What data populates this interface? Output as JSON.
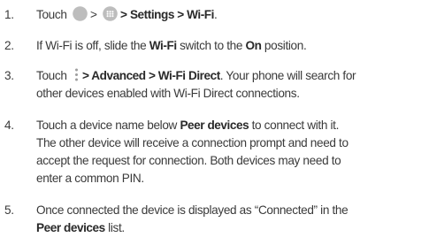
{
  "steps": [
    {
      "number": "1.",
      "touch": "Touch",
      "sep1": ">",
      "sep2": ">",
      "path": "Settings > Wi-Fi",
      "period": "."
    },
    {
      "number": "2.",
      "pre": "If Wi-Fi is off, slide the ",
      "bold1": "Wi-Fi",
      "mid": " switch to the ",
      "bold2": "On",
      "post": " position."
    },
    {
      "number": "3.",
      "touch": "Touch",
      "path": "> Advanced > Wi-Fi Direct",
      "rest_line1": ". Your phone will search for",
      "line2": "other devices enabled with Wi-Fi Direct connections."
    },
    {
      "number": "4.",
      "pre": "Touch a device name below ",
      "bold": "Peer devices",
      "post": " to connect with it.",
      "line2": "The other device will receive a connection prompt and need to",
      "line3": "accept the request for connection. Both devices may need to",
      "line4": "enter a common PIN."
    },
    {
      "number": "5.",
      "line1": "Once connected the device is displayed as “Connected” in the",
      "bold": "Peer devices",
      "post": " list."
    }
  ],
  "icons": {
    "home": "home-circle-icon",
    "apps": "apps-launcher-icon",
    "menu": "more-options-icon"
  },
  "colors": {
    "text": "#3a3a3a",
    "icon_gray": "#bdbdbd"
  }
}
